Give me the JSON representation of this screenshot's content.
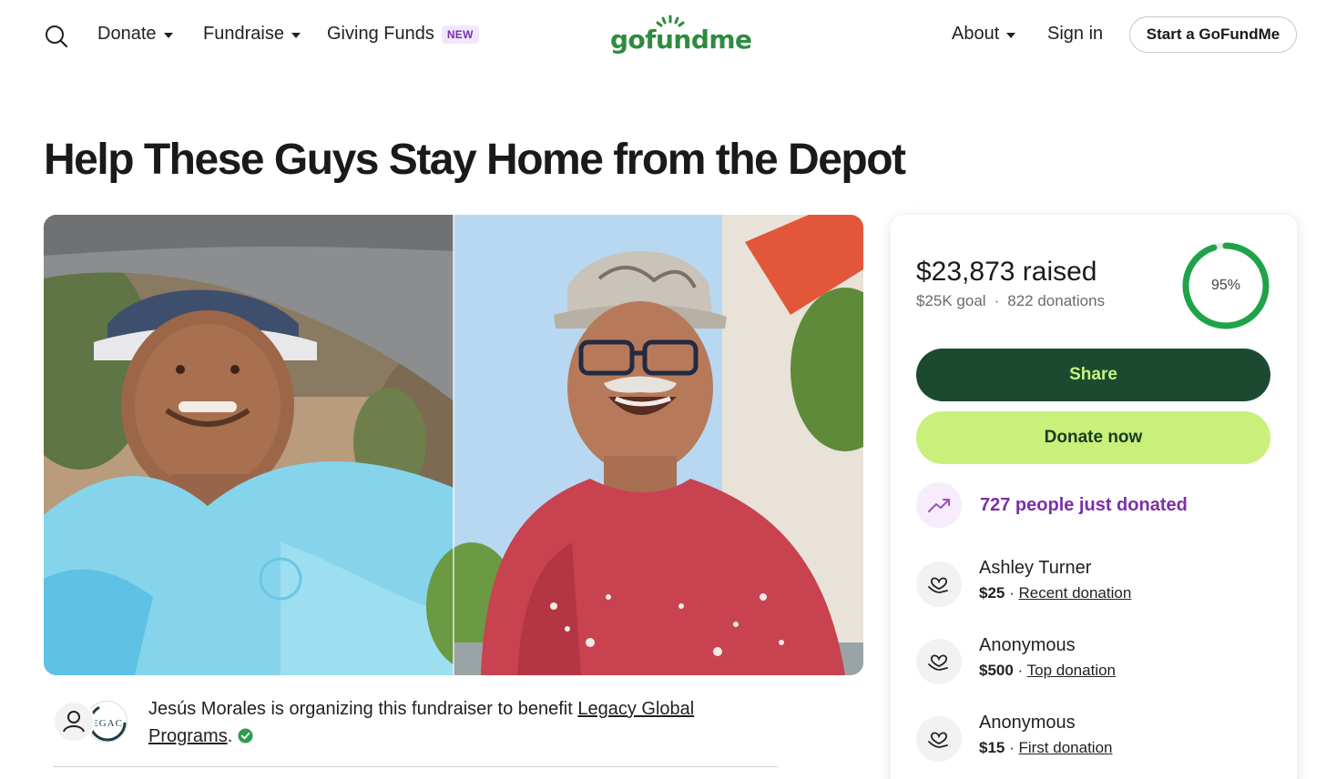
{
  "header": {
    "nav_left": [
      {
        "label": "Donate",
        "has_caret": true
      },
      {
        "label": "Fundraise",
        "has_caret": true
      },
      {
        "label": "Giving Funds",
        "badge": "NEW"
      }
    ],
    "logo_text": "gofundme",
    "nav_right": [
      {
        "label": "About",
        "has_caret": true
      },
      {
        "label": "Sign in"
      }
    ],
    "start_button": "Start a GoFundMe"
  },
  "page": {
    "title": "Help These Guys Stay Home from the Depot"
  },
  "organizer": {
    "logo_text": "EGAC",
    "text_prefix": "Jesús Morales is organizing this fundraiser to benefit ",
    "beneficiary_link": "Legacy Global Programs",
    "text_suffix": "."
  },
  "donation_card": {
    "raised": "$23,873 raised",
    "goal": "$25K goal",
    "separator": "·",
    "donations": "822 donations",
    "progress_percent": 95,
    "progress_label": "95%",
    "share_label": "Share",
    "donate_label": "Donate now",
    "trend_text": "727 people just donated",
    "donors": [
      {
        "name": "Ashley Turner",
        "amount": "$25",
        "sep": " · ",
        "tag": "Recent donation"
      },
      {
        "name": "Anonymous",
        "amount": "$500",
        "sep": " · ",
        "tag": "Top donation"
      },
      {
        "name": "Anonymous",
        "amount": "$15",
        "sep": " · ",
        "tag": "First donation"
      }
    ]
  },
  "colors": {
    "brand_green": "#2e8b3f",
    "share_bg": "#1c4a31",
    "donate_bg": "#c9f07a",
    "trend_purple": "#7b2fa6",
    "progress_green": "#1fa34a"
  },
  "icons": [
    "search-icon",
    "caret-down-icon",
    "trend-up-icon",
    "heart-hand-icon",
    "verified-check-icon",
    "person-icon"
  ]
}
